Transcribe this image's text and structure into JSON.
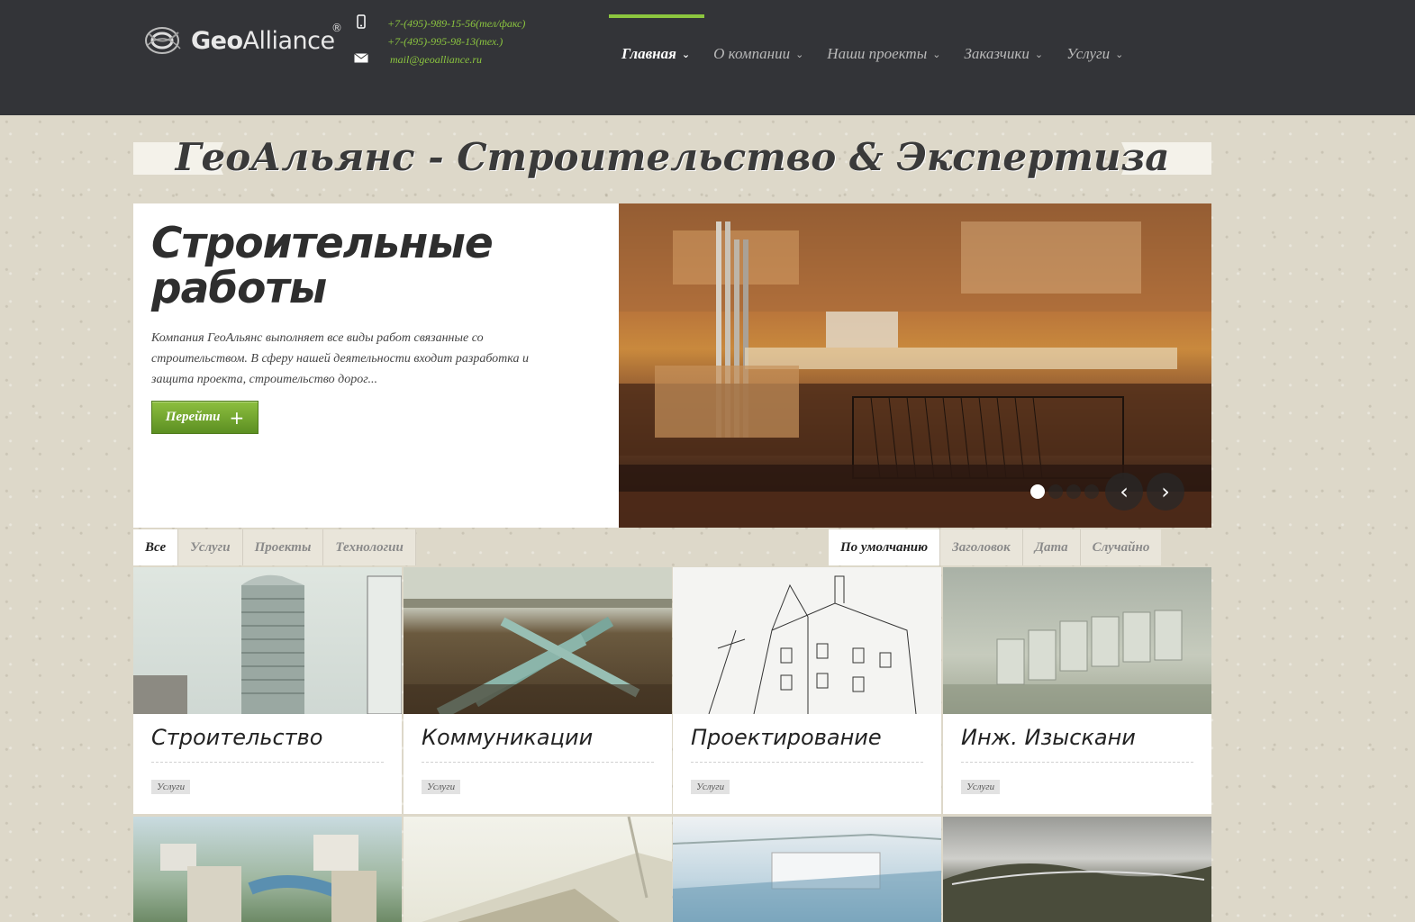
{
  "header": {
    "logo_prefix": "Geo",
    "logo_suffix": "Alliance",
    "logo_reg": "®",
    "contacts": [
      {
        "icon": "phone-icon",
        "text": "+7-(495)-989-15-56(тел/факс)"
      },
      {
        "icon": "phone-icon",
        "text": "+7-(495)-995-98-13(тех.)"
      },
      {
        "icon": "mail-icon",
        "text": "mail@geoalliance.ru"
      }
    ],
    "nav": [
      {
        "label": "Главная",
        "active": true
      },
      {
        "label": "О компании"
      },
      {
        "label": "Наши проекты"
      },
      {
        "label": "Заказчики"
      },
      {
        "label": "Услуги"
      }
    ],
    "accent_color": "#8cc63f"
  },
  "site_title": "ГеоАльянс - Строительство & Экспертиза",
  "slider": {
    "heading": "Строительные работы",
    "description": "Компания ГеоАльянс выполняет все виды работ связанные со строительством. В сферу нашей деятельности входит разработка и защита проекта, строительство дорог...",
    "button_label": "Перейти",
    "button_icon": "+",
    "slide_count": 4,
    "active_slide": 1,
    "prev_arrow": "‹",
    "next_arrow": "›"
  },
  "filters": {
    "categories": [
      "Все",
      "Услуги",
      "Проекты",
      "Технологии"
    ],
    "sort": [
      "По умолчанию",
      "Заголовок",
      "Дата",
      "Случайно"
    ]
  },
  "cards": [
    {
      "title": "Строительство",
      "tag": "Услуги"
    },
    {
      "title": "Коммуникации",
      "tag": "Услуги"
    },
    {
      "title": "Проектирование",
      "tag": "Услуги"
    },
    {
      "title": "Инж. Изыскани",
      "tag": "Услуги"
    }
  ]
}
